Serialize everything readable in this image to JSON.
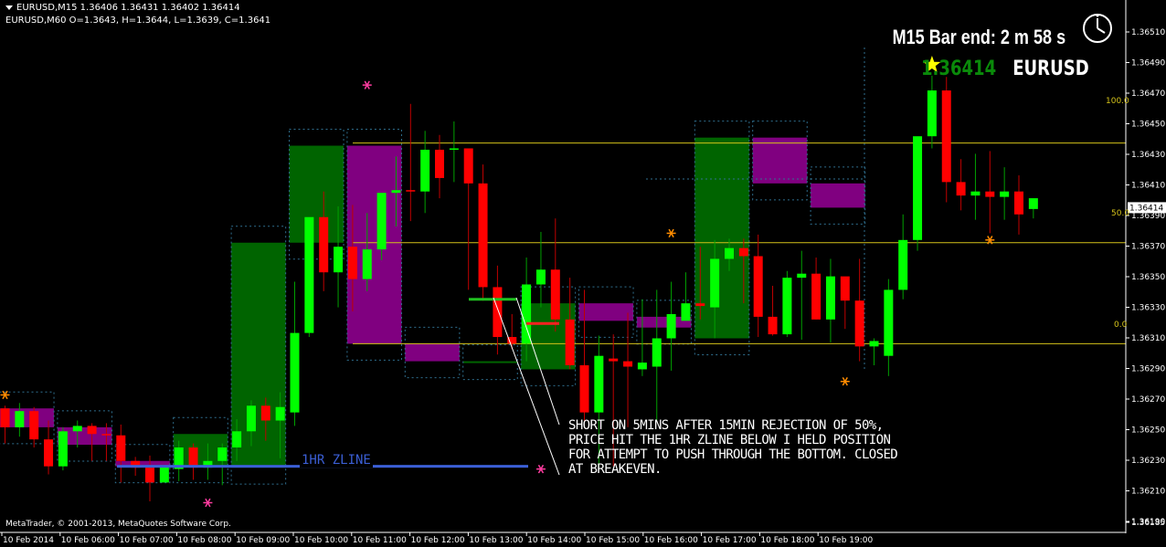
{
  "header": {
    "line1": "EURUSD,M15  1.36406 1.36431 1.36402 1.36414",
    "line2": "EURUSD,M60   O=1.3643,  H=1.3644,  L=1.3639,  C=1.3641"
  },
  "timer_text": "M15 Bar end: 2 m 58 s",
  "price_text": "1.36414",
  "symbol_text": "EURUSD",
  "copyright": "MetaTrader, © 2001-2013, MetaQuotes Software Corp.",
  "annotation": "SHORT ON 5MINS AFTER 15MIN REJECTION OF 50%, PRICE HIT THE 1HR ZLINE BELOW I HELD POSITION FOR ATTEMPT TO PUSH THROUGH THE BOTTOM. CLOSED AT BREAKEVEN.",
  "zline_label": "1HR ZLINE",
  "fib_labels": {
    "top": "100.0",
    "mid": "50.0",
    "bottom": "0.0"
  },
  "colors": {
    "bull": "#00ff00",
    "bear": "#ff0000",
    "h1_bull": "#006400",
    "h1_bear": "#800080",
    "fib": "#d4c21a",
    "zline": "#3b5fd6"
  },
  "chart_data": {
    "type": "candlestick",
    "symbol": "EURUSD",
    "timeframe": "M15",
    "ylim": [
      1.36175,
      1.3656
    ],
    "y_ticks": [
      "1.36510",
      "1.36490",
      "1.36470",
      "1.36450",
      "1.36430",
      "1.36410",
      "1.36390",
      "1.36370",
      "1.36350",
      "1.36330",
      "1.36310",
      "1.36290",
      "1.36270",
      "1.36250",
      "1.36230",
      "1.36210",
      "1.36190",
      "1.36185"
    ],
    "current_price": "1.36414",
    "x_labels": [
      "10 Feb 2014",
      "10 Feb 06:00",
      "10 Feb 07:00",
      "10 Feb 08:00",
      "10 Feb 09:00",
      "10 Feb 10:00",
      "10 Feb 11:00",
      "10 Feb 12:00",
      "10 Feb 13:00",
      "10 Feb 14:00",
      "10 Feb 15:00",
      "10 Feb 16:00",
      "10 Feb 17:00",
      "10 Feb 18:00",
      "10 Feb 19:00"
    ],
    "fib_levels": [
      {
        "label": "100.0",
        "price": 1.36462
      },
      {
        "label": "50.0",
        "price": 1.36388
      },
      {
        "label": "0.0",
        "price": 1.36313
      }
    ],
    "zline": {
      "label": "1HR ZLINE",
      "price": 1.36222,
      "from": 8,
      "to": 72
    },
    "candles": [
      [
        1.36265,
        1.36267,
        1.36239,
        1.36251
      ],
      [
        1.36251,
        1.36269,
        1.36244,
        1.36263
      ],
      [
        1.36263,
        1.36266,
        1.36236,
        1.36242
      ],
      [
        1.36242,
        1.36256,
        1.36216,
        1.36222
      ],
      [
        1.36222,
        1.36251,
        1.36219,
        1.36248
      ],
      [
        1.36248,
        1.36256,
        1.36236,
        1.36252
      ],
      [
        1.36252,
        1.36254,
        1.36226,
        1.36246
      ],
      [
        1.36246,
        1.36254,
        1.36226,
        1.36245
      ],
      [
        1.36245,
        1.36253,
        1.3621,
        1.36226
      ],
      [
        1.36226,
        1.36229,
        1.36215,
        1.36221
      ],
      [
        1.36221,
        1.3623,
        1.36196,
        1.3621
      ],
      [
        1.3621,
        1.36218,
        1.36213,
        1.36222
      ],
      [
        1.3622,
        1.36241,
        1.36211,
        1.36236
      ],
      [
        1.36236,
        1.36239,
        1.36212,
        1.36221
      ],
      [
        1.36221,
        1.36239,
        1.36212,
        1.36226
      ],
      [
        1.36226,
        1.36239,
        1.36208,
        1.36236
      ],
      [
        1.36236,
        1.36257,
        1.36226,
        1.36248
      ],
      [
        1.36248,
        1.36271,
        1.36237,
        1.36267
      ],
      [
        1.36267,
        1.36273,
        1.36241,
        1.36256
      ],
      [
        1.36256,
        1.36277,
        1.36228,
        1.36266
      ],
      [
        1.36262,
        1.36359,
        1.36252,
        1.36321
      ],
      [
        1.36321,
        1.36396,
        1.36318,
        1.36407
      ],
      [
        1.36407,
        1.36426,
        1.36352,
        1.36366
      ],
      [
        1.36366,
        1.36415,
        1.3634,
        1.36385
      ],
      [
        1.36385,
        1.36416,
        1.36337,
        1.36361
      ],
      [
        1.36361,
        1.3641,
        1.36352,
        1.36383
      ],
      [
        1.36383,
        1.3642,
        1.36375,
        1.36425
      ],
      [
        1.36425,
        1.36452,
        1.364,
        1.36427
      ],
      [
        1.36427,
        1.36491,
        1.36404,
        1.36426
      ],
      [
        1.36426,
        1.36471,
        1.3641,
        1.36457
      ],
      [
        1.36457,
        1.36468,
        1.36421,
        1.36436
      ],
      [
        1.36457,
        1.36478,
        1.36433,
        1.36458
      ],
      [
        1.36458,
        1.36451,
        1.36353,
        1.36432
      ],
      [
        1.36432,
        1.36446,
        1.36345,
        1.36355
      ],
      [
        1.36355,
        1.36371,
        1.36305,
        1.36318
      ],
      [
        1.36318,
        1.36335,
        1.36309,
        1.36313
      ],
      [
        1.36313,
        1.36377,
        1.363,
        1.36357
      ],
      [
        1.36357,
        1.36396,
        1.3634,
        1.36368
      ],
      [
        1.36368,
        1.36406,
        1.36322,
        1.36331
      ],
      [
        1.36331,
        1.36362,
        1.36294,
        1.36297
      ],
      [
        1.36297,
        1.36353,
        1.36256,
        1.36262
      ],
      [
        1.36262,
        1.36319,
        1.36222,
        1.36304
      ],
      [
        1.36302,
        1.3632,
        1.36222,
        1.363
      ],
      [
        1.363,
        1.36336,
        1.36251,
        1.36296
      ],
      [
        1.36294,
        1.36346,
        1.36289,
        1.36299
      ],
      [
        1.36296,
        1.36353,
        1.36256,
        1.36317
      ],
      [
        1.36317,
        1.36359,
        1.36293,
        1.36335
      ],
      [
        1.3633,
        1.36366,
        1.36331,
        1.36343
      ],
      [
        1.36343,
        1.36385,
        1.36331,
        1.36341
      ],
      [
        1.3634,
        1.3639,
        1.36317,
        1.36376
      ],
      [
        1.36376,
        1.36391,
        1.36367,
        1.36384
      ],
      [
        1.36384,
        1.36391,
        1.36343,
        1.36378
      ],
      [
        1.36378,
        1.36394,
        1.36318,
        1.36333
      ],
      [
        1.36333,
        1.36356,
        1.36319,
        1.3632
      ],
      [
        1.3632,
        1.36367,
        1.36318,
        1.36362
      ],
      [
        1.36362,
        1.36382,
        1.36316,
        1.36365
      ],
      [
        1.36365,
        1.36377,
        1.36331,
        1.36331
      ],
      [
        1.36331,
        1.36376,
        1.36314,
        1.36363
      ],
      [
        1.36363,
        1.36356,
        1.36324,
        1.36345
      ],
      [
        1.36345,
        1.36376,
        1.363,
        1.36311
      ],
      [
        1.36311,
        1.36317,
        1.36297,
        1.36315
      ],
      [
        1.36304,
        1.36361,
        1.36289,
        1.36353
      ],
      [
        1.36353,
        1.36409,
        1.36346,
        1.3639
      ],
      [
        1.3639,
        1.36466,
        1.36382,
        1.36467
      ],
      [
        1.36467,
        1.36512,
        1.36458,
        1.36501
      ],
      [
        1.36501,
        1.36511,
        1.36418,
        1.36433
      ],
      [
        1.36433,
        1.3645,
        1.36412,
        1.36423
      ],
      [
        1.36423,
        1.36454,
        1.36405,
        1.36426
      ],
      [
        1.36426,
        1.36456,
        1.36395,
        1.36422
      ],
      [
        1.36422,
        1.36444,
        1.36405,
        1.36426
      ],
      [
        1.36426,
        1.36438,
        1.36394,
        1.36409
      ],
      [
        1.36413,
        1.36418,
        1.36406,
        1.36421
      ]
    ],
    "h1_boxes": [
      {
        "start": 0,
        "end": 3,
        "open": 1.36265,
        "close": 1.36251
      },
      {
        "start": 4,
        "end": 7,
        "open": 1.36251,
        "close": 1.36238
      },
      {
        "start": 8,
        "end": 11,
        "open": 1.36226,
        "close": 1.36222
      },
      {
        "start": 12,
        "end": 15,
        "open": 1.36222,
        "close": 1.36246
      },
      {
        "start": 16,
        "end": 19,
        "open": 1.36221,
        "close": 1.36388
      },
      {
        "start": 20,
        "end": 23,
        "open": 1.36388,
        "close": 1.3646
      },
      {
        "start": 24,
        "end": 27,
        "open": 1.3646,
        "close": 1.36313
      },
      {
        "start": 28,
        "end": 31,
        "open": 1.36313,
        "close": 1.363
      },
      {
        "start": 32,
        "end": 35,
        "open": 1.363,
        "close": 1.363
      },
      {
        "start": 36,
        "end": 39,
        "open": 1.36294,
        "close": 1.36343
      },
      {
        "start": 40,
        "end": 43,
        "open": 1.36343,
        "close": 1.3633
      },
      {
        "start": 44,
        "end": 47,
        "open": 1.36333,
        "close": 1.36325
      },
      {
        "start": 48,
        "end": 51,
        "open": 1.36317,
        "close": 1.36466
      },
      {
        "start": 52,
        "end": 55,
        "open": 1.36466,
        "close": 1.36432
      },
      {
        "start": 56,
        "end": 59,
        "open": 1.36432,
        "close": 1.36414
      }
    ],
    "fractals": [
      {
        "i": 0,
        "price": 1.36275,
        "color": "#ff8c00"
      },
      {
        "i": 14,
        "price": 1.36195,
        "color": "#ff3ca0"
      },
      {
        "i": 25,
        "price": 1.36505,
        "color": "#ff3ca0"
      },
      {
        "i": 37,
        "price": 1.3622,
        "color": "#ff3ca0"
      },
      {
        "i": 46,
        "price": 1.36395,
        "color": "#ff8c00"
      },
      {
        "i": 58,
        "price": 1.36285,
        "color": "#ff8c00"
      },
      {
        "i": 64,
        "price": 1.3652,
        "color": "#ffff00"
      },
      {
        "i": 68,
        "price": 1.3639,
        "color": "#ff8c00"
      }
    ]
  }
}
